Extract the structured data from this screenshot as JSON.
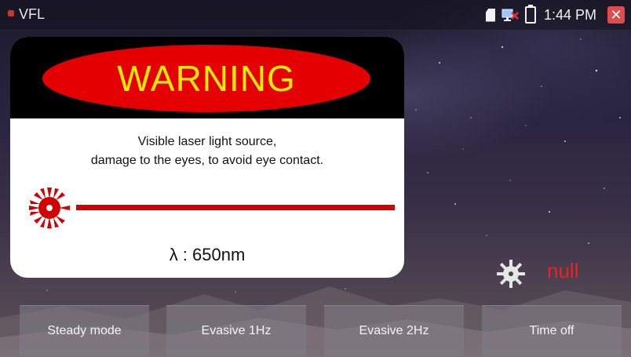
{
  "statusbar": {
    "title": "VFL",
    "time": "1:44 PM",
    "icons": [
      "app-icon",
      "sd-card-icon",
      "network-icon",
      "battery-icon",
      "close-icon"
    ],
    "close_color": "#e04b4b"
  },
  "warning_card": {
    "heading": "WARNING",
    "line1": "Visible laser light source,",
    "line2": "damage to the eyes, to avoid eye contact.",
    "wavelength": "λ : 650nm",
    "icons": [
      "laser-burst-icon"
    ],
    "colors": {
      "oval": "#e40000",
      "heading": "#ffea00",
      "laser": "#d20000"
    }
  },
  "indicator": {
    "status": "null",
    "icon": "gear-icon",
    "status_color": "#ff1a1a"
  },
  "buttons": {
    "steady": "Steady mode",
    "evasive_1hz": "Evasive 1Hz",
    "evasive_2hz": "Evasive 2Hz",
    "time_off": "Time off"
  }
}
